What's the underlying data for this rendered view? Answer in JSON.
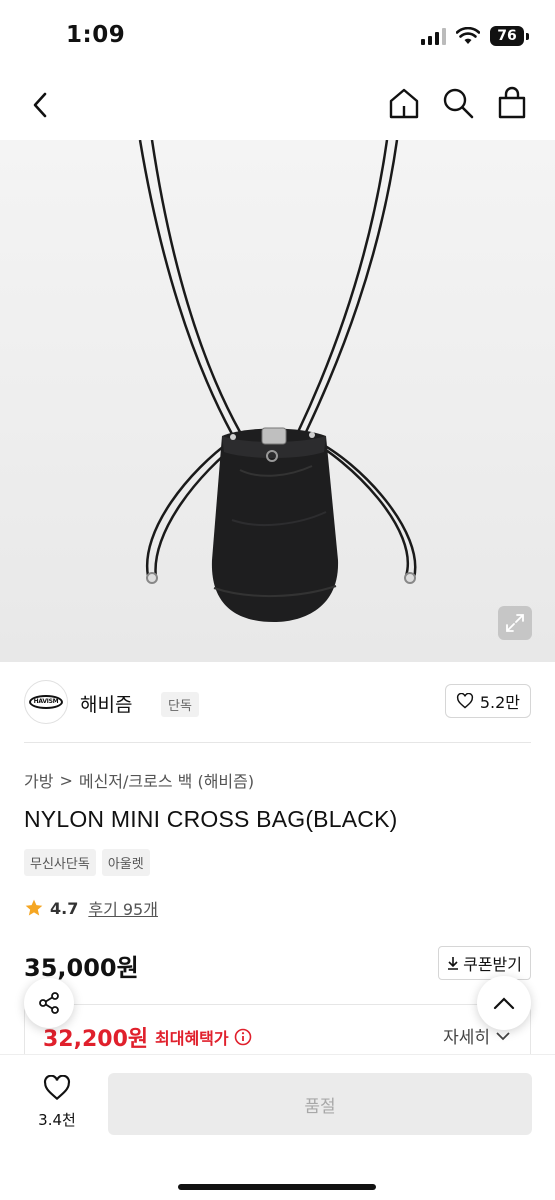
{
  "status_bar": {
    "time": "1:09",
    "battery": "76"
  },
  "nav": {
    "icons": [
      "chevron-left-icon",
      "home-icon",
      "search-icon",
      "shopping-bag-icon"
    ]
  },
  "brand": {
    "name": "해비즘",
    "badge": "단독",
    "logo_text": "HAVISM",
    "likes": "5.2만"
  },
  "breadcrumb": {
    "category": "가방",
    "separator": ">",
    "subcategory": "메신저/크로스 백 (해비즘)"
  },
  "product": {
    "title": "NYLON MINI CROSS BAG(BLACK)",
    "tags": [
      "무신사단독",
      "아울렛"
    ],
    "rating": "4.7",
    "reviews_label": "후기 95개",
    "price": "35,000원",
    "coupon_label": "쿠폰받기",
    "benefit_price": "32,200원",
    "benefit_label": "최대혜택가",
    "detail_label": "자세히"
  },
  "bottom_bar": {
    "wish_count": "3.4천",
    "soldout_label": "품절"
  },
  "colors": {
    "accent_red": "#e0202c",
    "disabled_bg": "#ebebeb"
  }
}
